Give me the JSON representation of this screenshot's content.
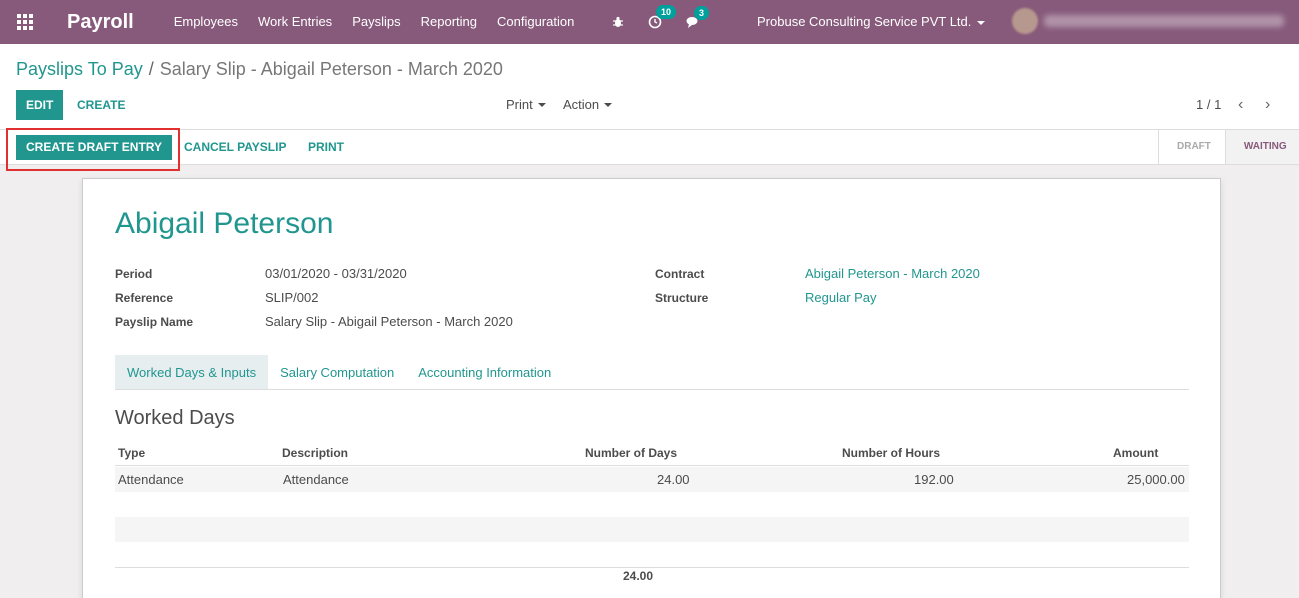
{
  "navbar": {
    "brand": "Payroll",
    "menu": [
      "Employees",
      "Work Entries",
      "Payslips",
      "Reporting",
      "Configuration"
    ],
    "activity_count": "10",
    "message_count": "3",
    "company": "Probuse Consulting Service PVT Ltd."
  },
  "breadcrumb": {
    "parent": "Payslips To Pay",
    "separator": "/",
    "current": "Salary Slip - Abigail Peterson - March 2020"
  },
  "toolbar": {
    "edit_label": "EDIT",
    "create_label": "CREATE",
    "print_label": "Print",
    "action_label": "Action",
    "pager": "1 / 1"
  },
  "statusbar": {
    "create_draft_label": "CREATE DRAFT ENTRY",
    "cancel_label": "CANCEL PAYSLIP",
    "print_label": "PRINT",
    "stages": [
      "DRAFT",
      "WAITING"
    ]
  },
  "form": {
    "employee": "Abigail Peterson",
    "period_label": "Period",
    "period": "03/01/2020 - 03/31/2020",
    "reference_label": "Reference",
    "reference": "SLIP/002",
    "payslip_name_label": "Payslip Name",
    "payslip_name": "Salary Slip - Abigail Peterson - March 2020",
    "contract_label": "Contract",
    "contract": "Abigail Peterson - March 2020",
    "structure_label": "Structure",
    "structure": "Regular Pay"
  },
  "tabs": [
    "Worked Days & Inputs",
    "Salary Computation",
    "Accounting Information"
  ],
  "worked_days": {
    "title": "Worked Days",
    "columns": [
      "Type",
      "Description",
      "Number of Days",
      "Number of Hours",
      "Amount"
    ],
    "rows": [
      {
        "type": "Attendance",
        "description": "Attendance",
        "days": "24.00",
        "hours": "192.00",
        "amount": "25,000.00"
      }
    ],
    "total_days": "24.00"
  }
}
